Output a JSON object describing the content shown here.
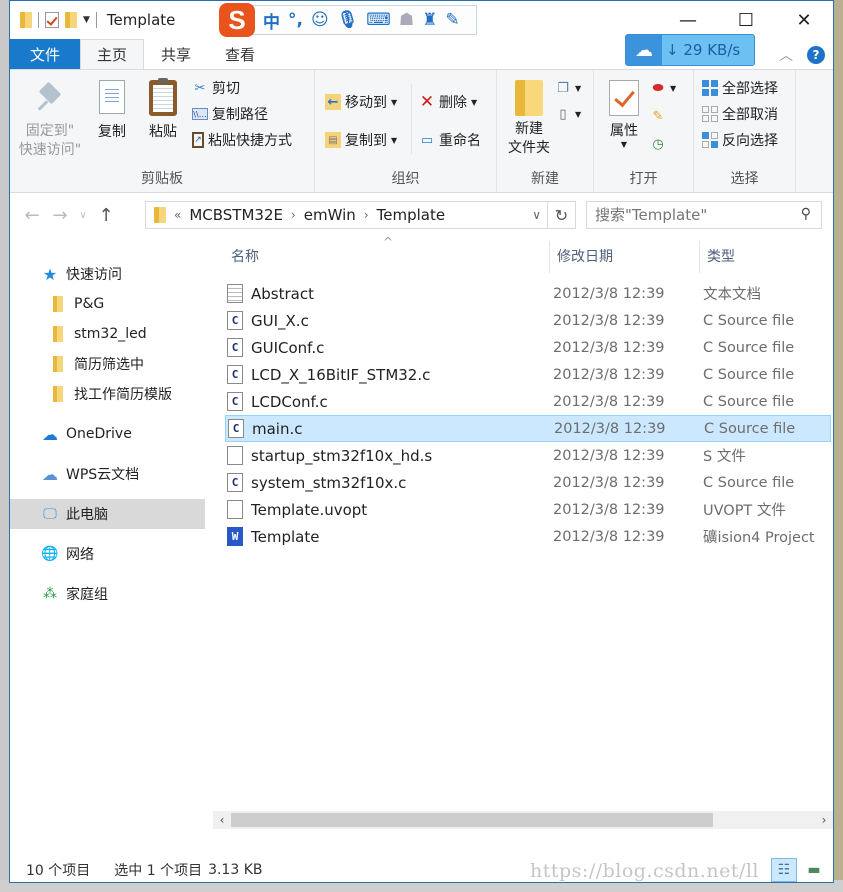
{
  "window": {
    "title": "Template",
    "controls": {
      "minimize": "—",
      "maximize": "☐",
      "close": "✕"
    }
  },
  "quick_access_toolbar": {
    "icons": [
      "folder-icon",
      "properties-check-icon",
      "new-folder-icon",
      "customize-dropdown-icon"
    ]
  },
  "ime_bar": {
    "logo": "S",
    "items": [
      "中",
      "°,",
      "☺",
      "🎤",
      "⌨",
      "👤",
      "👕",
      "🔧"
    ]
  },
  "ribbon_tabs": {
    "file": "文件",
    "home": "主页",
    "share": "共享",
    "view": "查看"
  },
  "baidu_widget": {
    "speed": "29 KB/s",
    "arrow": "↓"
  },
  "ribbon": {
    "clipboard": {
      "label": "剪贴板",
      "pin": "固定到\"快速访问\"",
      "pin_line1": "固定到\"",
      "pin_line2": "快速访问\"",
      "copy": "复制",
      "paste": "粘贴",
      "cut": "剪切",
      "copy_path": "复制路径",
      "paste_shortcut": "粘贴快捷方式"
    },
    "organize": {
      "label": "组织",
      "move_to": "移动到",
      "copy_to": "复制到",
      "delete": "删除",
      "rename": "重命名"
    },
    "new": {
      "label": "新建",
      "new_folder_line1": "新建",
      "new_folder_line2": "文件夹"
    },
    "open": {
      "label": "打开",
      "properties": "属性"
    },
    "select": {
      "label": "选择",
      "select_all": "全部选择",
      "select_none": "全部取消",
      "invert": "反向选择"
    }
  },
  "address_bar": {
    "overflow": "«",
    "path": [
      "MCBSTM32E",
      "emWin",
      "Template"
    ],
    "search_placeholder": "搜索\"Template\""
  },
  "nav_pane": {
    "items": [
      {
        "label": "快速访问",
        "icon": "star-icon"
      },
      {
        "label": "P&G",
        "icon": "folder-icon"
      },
      {
        "label": "stm32_led",
        "icon": "folder-icon"
      },
      {
        "label": "简历筛选中",
        "icon": "folder-icon"
      },
      {
        "label": "找工作简历模版",
        "icon": "folder-icon"
      },
      {
        "label": "OneDrive",
        "icon": "onedrive-cloud-icon"
      },
      {
        "label": "WPS云文档",
        "icon": "wps-cloud-icon"
      },
      {
        "label": "此电脑",
        "icon": "computer-icon",
        "selected": true
      },
      {
        "label": "网络",
        "icon": "network-icon"
      },
      {
        "label": "家庭组",
        "icon": "homegroup-icon"
      }
    ]
  },
  "file_list": {
    "columns": {
      "name": "名称",
      "date": "修改日期",
      "type": "类型"
    },
    "rows": [
      {
        "name": "Abstract",
        "date": "2012/3/8 12:39",
        "type": "文本文档",
        "icon": "text-file-icon"
      },
      {
        "name": "GUI_X.c",
        "date": "2012/3/8 12:39",
        "type": "C Source file",
        "icon": "c-file-icon"
      },
      {
        "name": "GUIConf.c",
        "date": "2012/3/8 12:39",
        "type": "C Source file",
        "icon": "c-file-icon"
      },
      {
        "name": "LCD_X_16BitIF_STM32.c",
        "date": "2012/3/8 12:39",
        "type": "C Source file",
        "icon": "c-file-icon"
      },
      {
        "name": "LCDConf.c",
        "date": "2012/3/8 12:39",
        "type": "C Source file",
        "icon": "c-file-icon"
      },
      {
        "name": "main.c",
        "date": "2012/3/8 12:39",
        "type": "C Source file",
        "icon": "c-file-icon",
        "selected": true
      },
      {
        "name": "startup_stm32f10x_hd.s",
        "date": "2012/3/8 12:39",
        "type": "S 文件",
        "icon": "blank-file-icon"
      },
      {
        "name": "system_stm32f10x.c",
        "date": "2012/3/8 12:39",
        "type": "C Source file",
        "icon": "c-file-icon"
      },
      {
        "name": "Template.uvopt",
        "date": "2012/3/8 12:39",
        "type": "UVOPT 文件",
        "icon": "blank-file-icon"
      },
      {
        "name": "Template",
        "date": "2012/3/8 12:39",
        "type": "礦ision4 Project",
        "icon": "uvision-project-icon"
      }
    ]
  },
  "status_bar": {
    "item_count": "10 个项目",
    "selected": "选中 1 个项目",
    "size": "3.13 KB"
  },
  "watermark": "https://blog.csdn.net/ll"
}
